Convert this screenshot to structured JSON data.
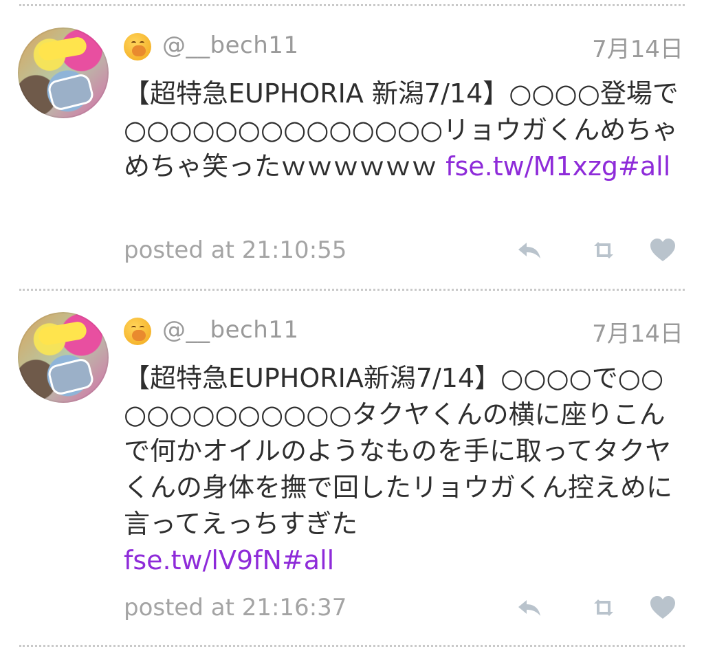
{
  "tweets": [
    {
      "user": {
        "handle": "@__bech11",
        "emoji_icon": "face-with-hand-over-mouth-icon"
      },
      "date": "7月14日",
      "text": "【超特急EUPHORIA 新潟7/14】○○○○登場で○○○○○○○○○○○○○○リョウガくんめちゃめちゃ笑ったｗｗｗｗｗｗ ",
      "link": "fse.tw/M1xzg#all",
      "posted": "posted at 21:10:55"
    },
    {
      "user": {
        "handle": "@__bech11",
        "emoji_icon": "face-with-hand-over-mouth-icon"
      },
      "date": "7月14日",
      "text": "【超特急EUPHORIA新潟7/14】○○○○で○○○○○○○○○○○○タクヤくんの横に座りこんで何かオイルのようなものを手に取ってタクヤくんの身体を撫で回したリョウガくん控えめに言ってえっちすぎた",
      "link": "fse.tw/lV9fN#all",
      "posted": "posted at 21:16:37"
    }
  ],
  "icons": {
    "reply": "reply-icon",
    "retweet": "retweet-icon",
    "like": "heart-icon"
  },
  "colors": {
    "link": "#8e2bd9",
    "meta_text": "#9a9a9a",
    "icon": "#b9c3cc",
    "divider": "#c9c9c9"
  }
}
